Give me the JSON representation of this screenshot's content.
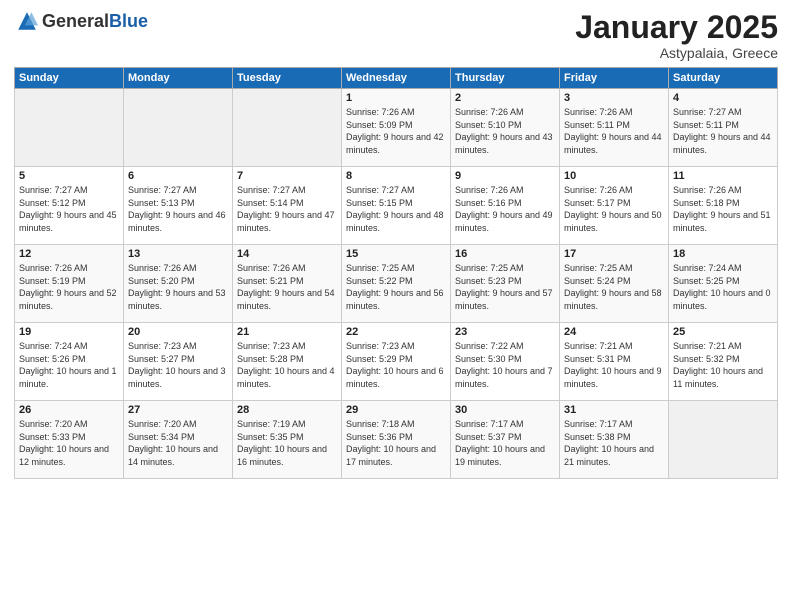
{
  "header": {
    "logo_general": "General",
    "logo_blue": "Blue",
    "title": "January 2025",
    "subtitle": "Astypalaia, Greece"
  },
  "days_of_week": [
    "Sunday",
    "Monday",
    "Tuesday",
    "Wednesday",
    "Thursday",
    "Friday",
    "Saturday"
  ],
  "weeks": [
    {
      "cells": [
        {
          "empty": true
        },
        {
          "empty": true
        },
        {
          "empty": true
        },
        {
          "day": 1,
          "sunrise": "7:26 AM",
          "sunset": "5:09 PM",
          "daylight": "9 hours and 42 minutes."
        },
        {
          "day": 2,
          "sunrise": "7:26 AM",
          "sunset": "5:10 PM",
          "daylight": "9 hours and 43 minutes."
        },
        {
          "day": 3,
          "sunrise": "7:26 AM",
          "sunset": "5:11 PM",
          "daylight": "9 hours and 44 minutes."
        },
        {
          "day": 4,
          "sunrise": "7:27 AM",
          "sunset": "5:11 PM",
          "daylight": "9 hours and 44 minutes."
        }
      ]
    },
    {
      "cells": [
        {
          "day": 5,
          "sunrise": "7:27 AM",
          "sunset": "5:12 PM",
          "daylight": "9 hours and 45 minutes."
        },
        {
          "day": 6,
          "sunrise": "7:27 AM",
          "sunset": "5:13 PM",
          "daylight": "9 hours and 46 minutes."
        },
        {
          "day": 7,
          "sunrise": "7:27 AM",
          "sunset": "5:14 PM",
          "daylight": "9 hours and 47 minutes."
        },
        {
          "day": 8,
          "sunrise": "7:27 AM",
          "sunset": "5:15 PM",
          "daylight": "9 hours and 48 minutes."
        },
        {
          "day": 9,
          "sunrise": "7:26 AM",
          "sunset": "5:16 PM",
          "daylight": "9 hours and 49 minutes."
        },
        {
          "day": 10,
          "sunrise": "7:26 AM",
          "sunset": "5:17 PM",
          "daylight": "9 hours and 50 minutes."
        },
        {
          "day": 11,
          "sunrise": "7:26 AM",
          "sunset": "5:18 PM",
          "daylight": "9 hours and 51 minutes."
        }
      ]
    },
    {
      "cells": [
        {
          "day": 12,
          "sunrise": "7:26 AM",
          "sunset": "5:19 PM",
          "daylight": "9 hours and 52 minutes."
        },
        {
          "day": 13,
          "sunrise": "7:26 AM",
          "sunset": "5:20 PM",
          "daylight": "9 hours and 53 minutes."
        },
        {
          "day": 14,
          "sunrise": "7:26 AM",
          "sunset": "5:21 PM",
          "daylight": "9 hours and 54 minutes."
        },
        {
          "day": 15,
          "sunrise": "7:25 AM",
          "sunset": "5:22 PM",
          "daylight": "9 hours and 56 minutes."
        },
        {
          "day": 16,
          "sunrise": "7:25 AM",
          "sunset": "5:23 PM",
          "daylight": "9 hours and 57 minutes."
        },
        {
          "day": 17,
          "sunrise": "7:25 AM",
          "sunset": "5:24 PM",
          "daylight": "9 hours and 58 minutes."
        },
        {
          "day": 18,
          "sunrise": "7:24 AM",
          "sunset": "5:25 PM",
          "daylight": "10 hours and 0 minutes."
        }
      ]
    },
    {
      "cells": [
        {
          "day": 19,
          "sunrise": "7:24 AM",
          "sunset": "5:26 PM",
          "daylight": "10 hours and 1 minute."
        },
        {
          "day": 20,
          "sunrise": "7:23 AM",
          "sunset": "5:27 PM",
          "daylight": "10 hours and 3 minutes."
        },
        {
          "day": 21,
          "sunrise": "7:23 AM",
          "sunset": "5:28 PM",
          "daylight": "10 hours and 4 minutes."
        },
        {
          "day": 22,
          "sunrise": "7:23 AM",
          "sunset": "5:29 PM",
          "daylight": "10 hours and 6 minutes."
        },
        {
          "day": 23,
          "sunrise": "7:22 AM",
          "sunset": "5:30 PM",
          "daylight": "10 hours and 7 minutes."
        },
        {
          "day": 24,
          "sunrise": "7:21 AM",
          "sunset": "5:31 PM",
          "daylight": "10 hours and 9 minutes."
        },
        {
          "day": 25,
          "sunrise": "7:21 AM",
          "sunset": "5:32 PM",
          "daylight": "10 hours and 11 minutes."
        }
      ]
    },
    {
      "cells": [
        {
          "day": 26,
          "sunrise": "7:20 AM",
          "sunset": "5:33 PM",
          "daylight": "10 hours and 12 minutes."
        },
        {
          "day": 27,
          "sunrise": "7:20 AM",
          "sunset": "5:34 PM",
          "daylight": "10 hours and 14 minutes."
        },
        {
          "day": 28,
          "sunrise": "7:19 AM",
          "sunset": "5:35 PM",
          "daylight": "10 hours and 16 minutes."
        },
        {
          "day": 29,
          "sunrise": "7:18 AM",
          "sunset": "5:36 PM",
          "daylight": "10 hours and 17 minutes."
        },
        {
          "day": 30,
          "sunrise": "7:17 AM",
          "sunset": "5:37 PM",
          "daylight": "10 hours and 19 minutes."
        },
        {
          "day": 31,
          "sunrise": "7:17 AM",
          "sunset": "5:38 PM",
          "daylight": "10 hours and 21 minutes."
        },
        {
          "empty": true
        }
      ]
    }
  ]
}
